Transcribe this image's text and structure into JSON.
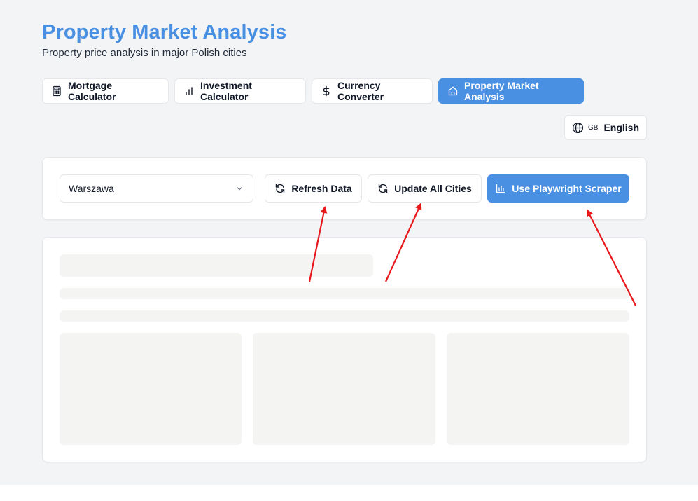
{
  "header": {
    "title": "Property Market Analysis",
    "subtitle": "Property price analysis in major Polish cities"
  },
  "tabs": [
    {
      "label": "Mortgage Calculator",
      "icon": "calculator-icon",
      "active": false
    },
    {
      "label": "Investment Calculator",
      "icon": "bar-chart-icon",
      "active": false
    },
    {
      "label": "Currency Converter",
      "icon": "dollar-icon",
      "active": false
    },
    {
      "label": "Property Market Analysis",
      "icon": "home-icon",
      "active": true
    }
  ],
  "language": {
    "flag_code": "GB",
    "label": "English",
    "icon": "globe-icon"
  },
  "controls": {
    "city_select": {
      "value": "Warszawa",
      "icon": "chevron-down-icon"
    },
    "refresh_label": "Refresh Data",
    "update_all_label": "Update All Cities",
    "scraper_label": "Use Playwright Scraper"
  },
  "colors": {
    "accent": "#4a90e2",
    "page_background": "#f3f4f6",
    "annotation_arrow": "#e8171b",
    "skeleton": "#f4f4f3"
  }
}
